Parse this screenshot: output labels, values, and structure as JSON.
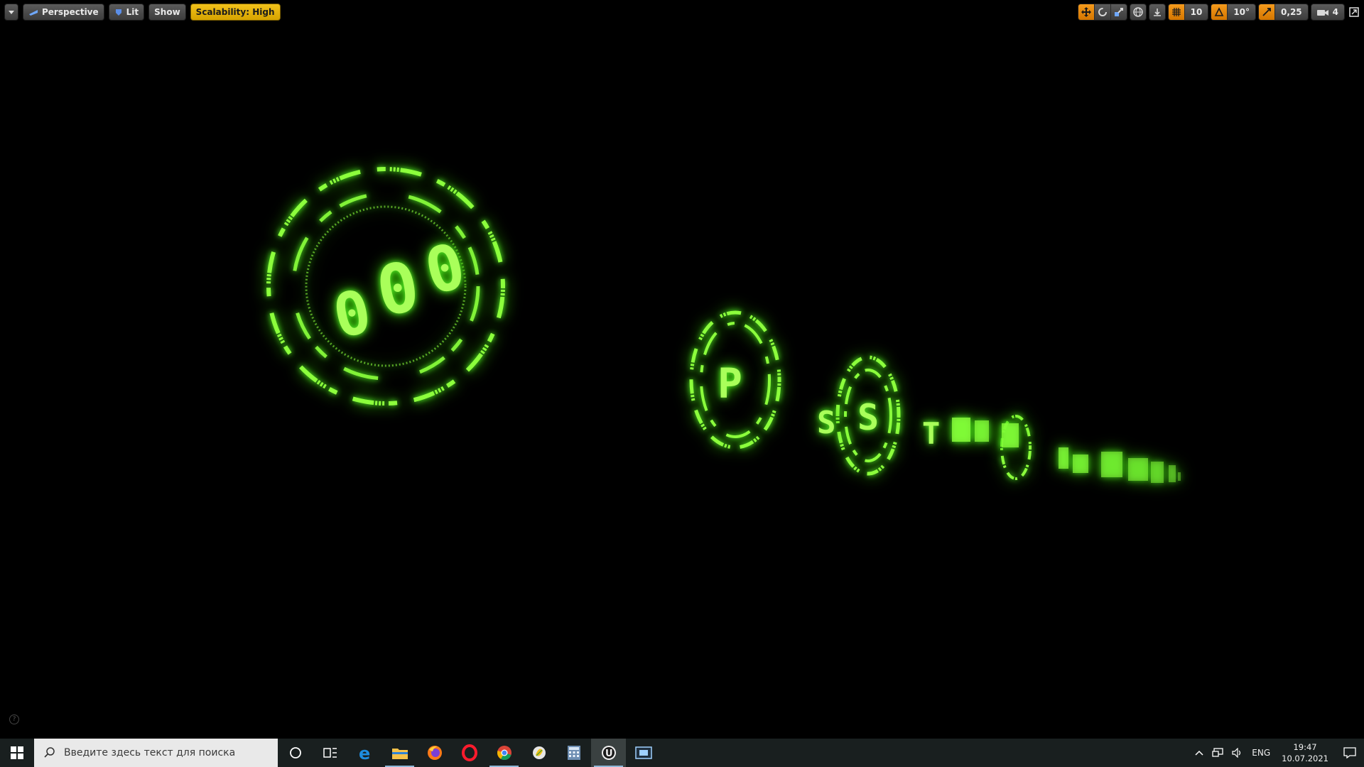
{
  "viewport_toolbar": {
    "perspective_label": "Perspective",
    "lit_label": "Lit",
    "show_label": "Show",
    "scalability_label": "Scalability: High",
    "grid_snap_value": "10",
    "rotation_snap_value": "10°",
    "scale_snap_value": "0,25",
    "camera_speed_value": "4"
  },
  "scene": {
    "glyphs": [
      "0",
      "0",
      "0",
      "P",
      "S",
      "S",
      "T"
    ]
  },
  "taskbar": {
    "search_placeholder": "Введите здесь текст для поиска",
    "language": "ENG",
    "time": "19:47",
    "date": "10.07.2021"
  },
  "colors": {
    "glow_green": "#7dff3a",
    "scalability_yellow": "#f2c21a",
    "toolbar_orange": "#f49a1c",
    "taskbar_bg": "#191f1f"
  }
}
